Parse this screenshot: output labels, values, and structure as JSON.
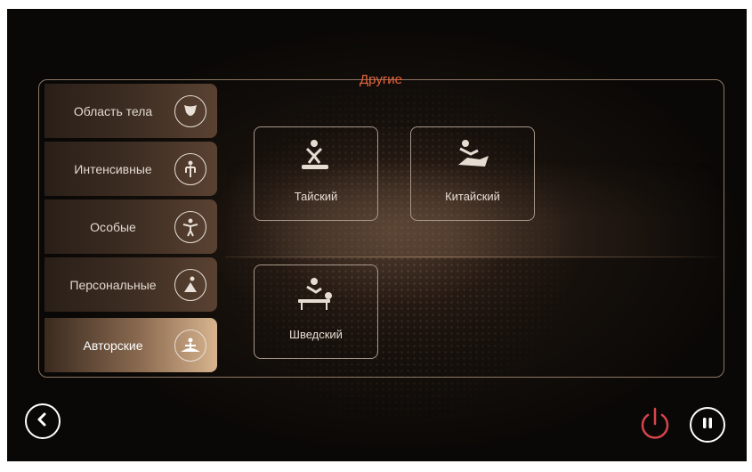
{
  "header": {
    "title": "Другие"
  },
  "sidebar": {
    "tabs": [
      {
        "label": "Область тела",
        "icon": "body-area-icon",
        "active": false
      },
      {
        "label": "Интенсивные",
        "icon": "human-figure-icon",
        "active": false
      },
      {
        "label": "Особые",
        "icon": "stretch-figure-icon",
        "active": false
      },
      {
        "label": "Персональные",
        "icon": "yoga-pose-icon",
        "active": false
      },
      {
        "label": "Авторские",
        "icon": "meditation-icon",
        "active": true
      }
    ]
  },
  "programs": [
    {
      "label": "Тайский",
      "icon": "thai-massage-icon"
    },
    {
      "label": "Китайский",
      "icon": "chinese-massage-icon"
    },
    {
      "label": "Шведский",
      "icon": "swedish-massage-icon"
    }
  ],
  "controls": {
    "back_icon": "chevron-left-icon",
    "power_icon": "power-icon",
    "pause_icon": "pause-icon"
  },
  "colors": {
    "accent": "#e3643c",
    "power": "#d8454c",
    "background": "#0b0908",
    "border": "#8c7765"
  }
}
